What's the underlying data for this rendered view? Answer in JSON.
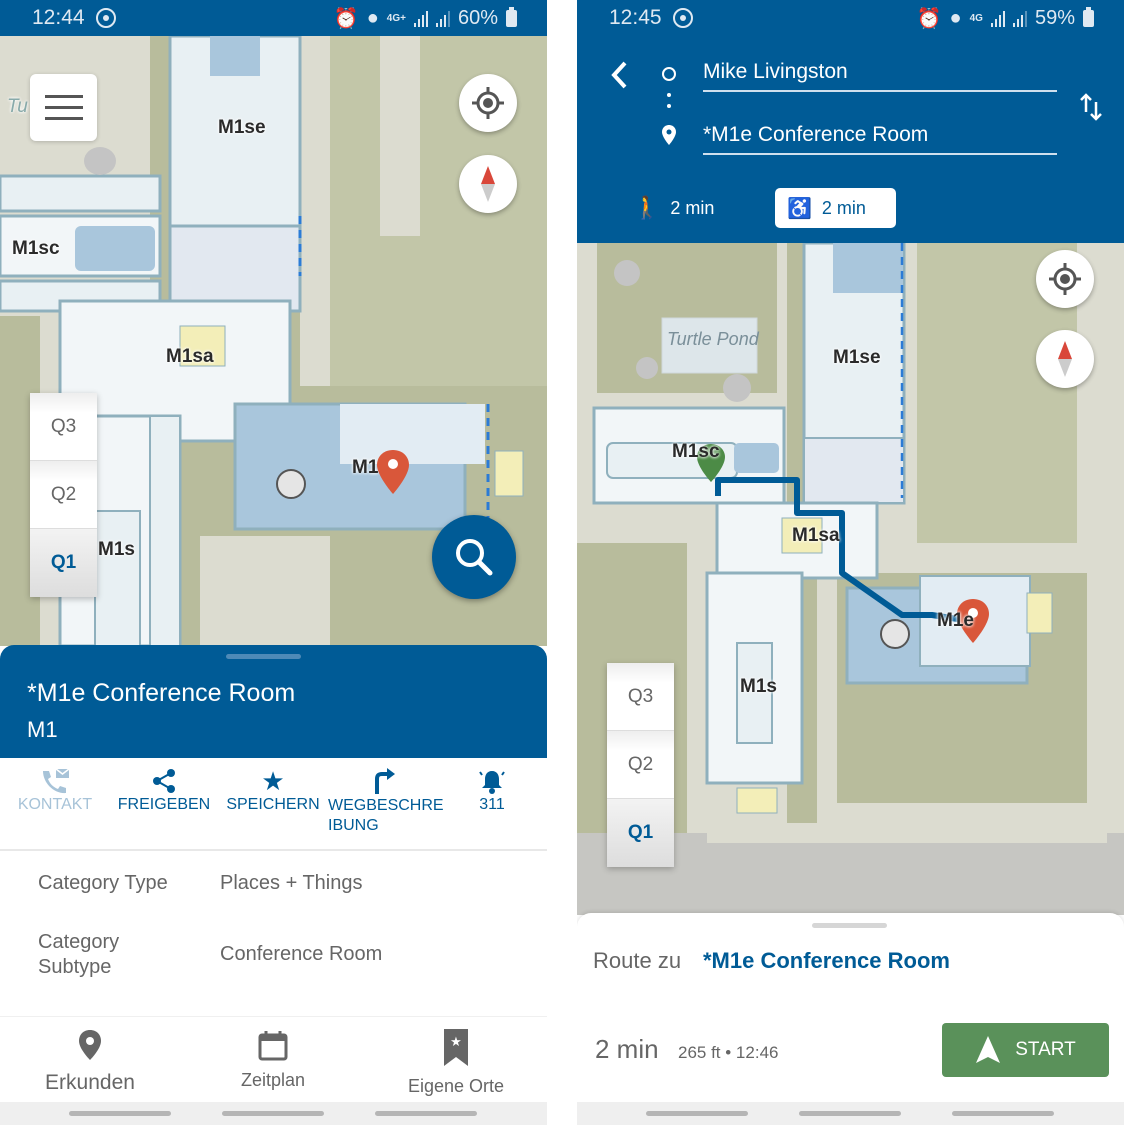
{
  "left_screen": {
    "status_bar": {
      "time": "12:44",
      "network": "4G+",
      "battery": "60%"
    },
    "map": {
      "menu_button": "menu",
      "building_labels": [
        "M1se",
        "M1sc",
        "M1sa",
        "M1e",
        "M1s"
      ],
      "partial_label": "Tu",
      "floors": [
        "Q3",
        "Q2",
        "Q1"
      ],
      "active_floor": "Q1"
    },
    "place": {
      "title": "*M1e Conference Room",
      "subtitle": "M1"
    },
    "actions": [
      {
        "label": "KONTAKT",
        "icon": "phone-mail-icon",
        "enabled": false
      },
      {
        "label": "FREIGEBEN",
        "icon": "share-icon",
        "enabled": true
      },
      {
        "label": "SPEICHERN",
        "icon": "star-icon",
        "enabled": true
      },
      {
        "label": "WEGBESCHRE IBUNG",
        "icon": "directions-icon",
        "enabled": true
      },
      {
        "label": "311",
        "icon": "bell-icon",
        "enabled": true
      }
    ],
    "details": [
      {
        "key": "Category Type",
        "value": "Places + Things"
      },
      {
        "key": "Category Subtype",
        "value": "Conference Room"
      }
    ],
    "bottom_nav": [
      {
        "label": "Erkunden",
        "icon": "place-pin-icon"
      },
      {
        "label": "Zeitplan",
        "icon": "calendar-icon"
      },
      {
        "label": "Eigene Orte",
        "icon": "bookmark-star-icon"
      }
    ]
  },
  "right_screen": {
    "status_bar": {
      "time": "12:45",
      "network": "4G",
      "battery": "59%"
    },
    "route_form": {
      "origin": "Mike Livingston",
      "destination": "*M1e Conference Room",
      "modes": [
        {
          "mode": "walk",
          "time": "2 min",
          "active": false
        },
        {
          "mode": "wheelchair",
          "time": "2 min",
          "active": true
        }
      ]
    },
    "map": {
      "pond_label": "Turtle Pond",
      "building_labels": [
        "M1se",
        "M1sc",
        "M1sa",
        "M1e",
        "M1s"
      ],
      "floors": [
        "Q3",
        "Q2",
        "Q1"
      ],
      "active_floor": "Q1"
    },
    "route_summary": {
      "prefix": "Route zu",
      "destination": "*M1e Conference Room",
      "duration": "2 min",
      "meta": "265 ft • 12:46",
      "start_label": "START"
    }
  },
  "colors": {
    "brand_blue": "#005b96",
    "marker_red": "#d9573a",
    "start_green": "#5a915a",
    "origin_green": "#4c8b46"
  }
}
